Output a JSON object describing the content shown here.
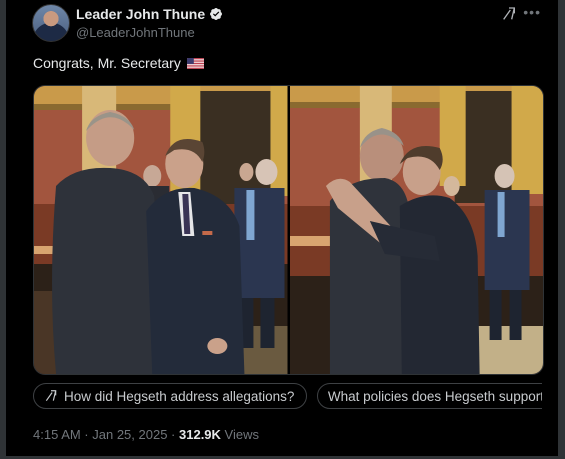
{
  "post": {
    "author": {
      "display_name": "Leader John Thune",
      "handle": "@LeaderJohnThune",
      "verified": true
    },
    "text": "Congrats, Mr. Secretary",
    "emoji": "us-flag",
    "media_count": 2,
    "timestamp": "4:15 AM · Jan 25, 2025",
    "separator": " · ",
    "views": "312.9K",
    "views_label": "Views"
  },
  "suggestions": [
    {
      "label": "How did Hegseth address allegations?",
      "icon": "grok-icon"
    },
    {
      "label": "What policies does Hegseth support?",
      "icon": "grok-icon"
    }
  ],
  "colors": {
    "background": "#000000",
    "text_primary": "#e7e9ea",
    "text_secondary": "#71767b",
    "verified_badge": "#e7e9ea"
  }
}
